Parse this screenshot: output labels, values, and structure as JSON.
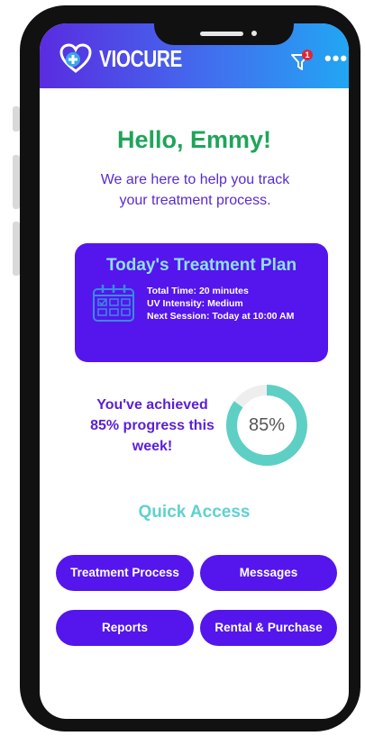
{
  "app": {
    "brand": "VIOCURE"
  },
  "header": {
    "notification_count": "1"
  },
  "greeting": {
    "title": "Hello, Emmy!",
    "subtitle": "We are here to help you track your treatment process."
  },
  "plan": {
    "title": "Today's Treatment Plan",
    "lines": [
      "Total Time: 20 minutes",
      "UV Intensity: Medium",
      "Next Session: Today at 10:00 AM"
    ]
  },
  "progress": {
    "text": "You've achieved 85% progress this week!",
    "value": 85,
    "label": "85%"
  },
  "quick_access": {
    "title": "Quick Access",
    "buttons": [
      "Treatment Process",
      "Messages",
      "Reports",
      "Rental & Purchase"
    ]
  },
  "colors": {
    "accent": "#5416ec",
    "greeting": "#1ea55a",
    "donut_fill": "#5ecfc4",
    "donut_track": "#eeeeee"
  }
}
